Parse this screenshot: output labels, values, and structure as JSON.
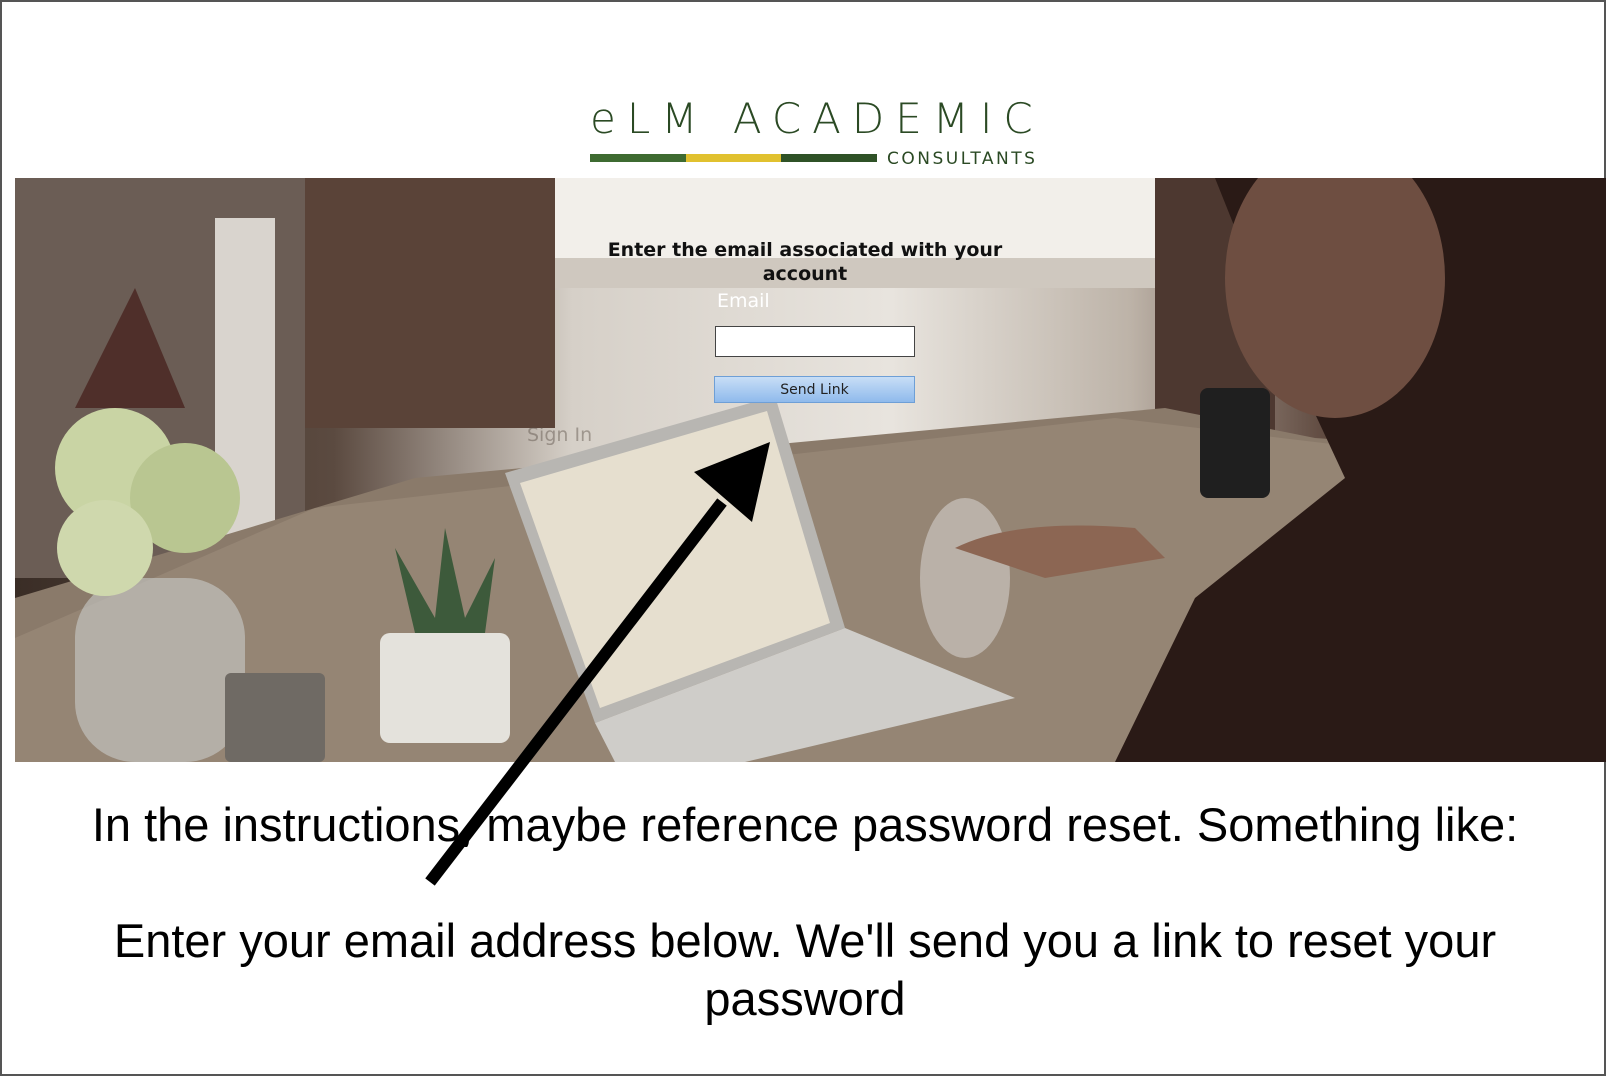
{
  "logo": {
    "wordmark": "eLM ACADEMIC",
    "subtitle": "CONSULTANTS",
    "colors": [
      "#3e6b31",
      "#e1c12f",
      "#2f5227"
    ]
  },
  "form": {
    "title": "Enter the email associated with your account",
    "email_label": "Email",
    "email_value": "",
    "send_button_label": "Send Link",
    "signin_link_label": "Sign In"
  },
  "annotation": {
    "line1": "In the instructions, maybe reference password reset. Something like:",
    "line2": "Enter your email address below. We'll send you a link to reset your password",
    "arrow_icon": "arrow-icon"
  },
  "colors": {
    "button_gradient_top": "#c8def6",
    "button_gradient_bottom": "#8fbaec",
    "logo_green": "#2b4a24"
  }
}
